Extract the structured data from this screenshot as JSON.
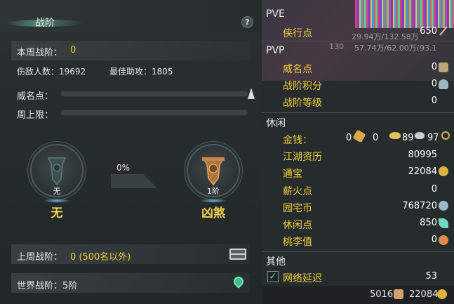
{
  "left": {
    "title": "战阶",
    "help": "?",
    "week_rank_label": "本周战阶：",
    "week_rank_value": "0",
    "kills_label": "伤敌人数：19692",
    "assists_label": "最佳助攻：1805",
    "fame_label": "威名点：",
    "week_cap_label": "周上限：",
    "progress_percent": "0%",
    "current_medal_level": "无",
    "current_rank_name": "无",
    "next_medal_level": "1阶",
    "next_rank_name": "凶煞",
    "last_week_label": "上周战阶：",
    "last_week_value": "0 (500名以外)",
    "world_rank_label": "世界战阶：5阶"
  },
  "right": {
    "top_partial_text": "29.94万/132.58万",
    "top_partial_text2": "57.74万/62.00万(93.1",
    "top_partial_num": "130",
    "pve_header": "PVE",
    "pve_items": [
      {
        "label": "侠行点",
        "value": "650"
      }
    ],
    "pvp_header": "PVP",
    "pvp_items": [
      {
        "label": "威名点",
        "value": "0"
      },
      {
        "label": "战阶积分",
        "value": "0"
      },
      {
        "label": "战阶等级",
        "value": "0"
      }
    ],
    "leisure_header": "休闲",
    "money_label": "金钱：",
    "money_values": [
      "0",
      "0",
      "89",
      "97"
    ],
    "leisure_items": [
      {
        "label": "江湖资历",
        "value": "80995"
      },
      {
        "label": "通宝",
        "value": "22084"
      },
      {
        "label": "薪火点",
        "value": "0"
      },
      {
        "label": "园宅币",
        "value": "768720"
      },
      {
        "label": "休闲点",
        "value": "850"
      },
      {
        "label": "桃李值",
        "value": "0"
      }
    ],
    "other_header": "其他",
    "latency_label": "网络延迟",
    "latency_value": "53",
    "bottom_left_value": "5016",
    "bottom_right_value": "22084"
  },
  "colors": {
    "accent_yellow": "#f2cf3d",
    "latency_check": "#4ec6b5"
  }
}
